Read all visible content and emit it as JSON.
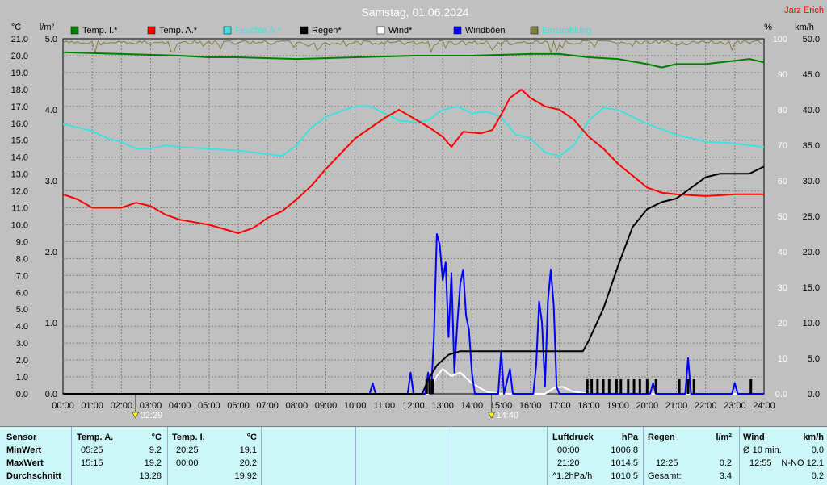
{
  "title": "Samstag, 01.06.2024",
  "author": "Jarz Erich",
  "colors": {
    "temp_i": "#008000",
    "temp_a": "#ff0000",
    "feuchte_a": "#40e0e0",
    "regen": "#000000",
    "wind": "#ffffff",
    "windboeen": "#0000ff",
    "einstrahlung": "#808040"
  },
  "chart_data": {
    "type": "line",
    "x_unit": "time of day (h)",
    "x_ticks": [
      "00:00",
      "01:00",
      "02:00",
      "03:00",
      "04:00",
      "05:00",
      "06:00",
      "07:00",
      "08:00",
      "09:00",
      "10:00",
      "11:00",
      "12:00",
      "13:00",
      "14:00",
      "15:00",
      "16:00",
      "17:00",
      "18:00",
      "19:00",
      "20:00",
      "21:00",
      "22:00",
      "23:00",
      "24:00"
    ],
    "y_left_temp": {
      "label": "°C",
      "range": [
        0,
        21
      ],
      "ticks": [
        "0.0",
        "1.0",
        "2.0",
        "3.0",
        "4.0",
        "5.0",
        "6.0",
        "7.0",
        "8.0",
        "9.0",
        "10.0",
        "11.0",
        "12.0",
        "13.0",
        "14.0",
        "15.0",
        "16.0",
        "17.0",
        "18.0",
        "19.0",
        "20.0",
        "21.0"
      ]
    },
    "y_left_rain": {
      "label": "l/m²",
      "range": [
        0,
        5
      ],
      "ticks": [
        "0.0",
        "1.0",
        "2.0",
        "3.0",
        "4.0",
        "5.0"
      ]
    },
    "y_right_hum": {
      "label": "%",
      "range": [
        0,
        100
      ],
      "ticks": [
        "0.0",
        "10",
        "20",
        "30",
        "40",
        "50",
        "60",
        "70",
        "80",
        "90",
        "100"
      ]
    },
    "y_right_wind": {
      "label": "km/h",
      "range": [
        0,
        50
      ],
      "ticks": [
        "0.0",
        "5.0",
        "10.0",
        "15.0",
        "20.0",
        "25.0",
        "30.0",
        "35.0",
        "40.0",
        "45.0",
        "50.0"
      ]
    },
    "legend": [
      "Temp. I.*",
      "Temp. A.*",
      "Feuchte A.*",
      "Regen*",
      "Wind*",
      "Windböen",
      "Einstrahlung"
    ],
    "sun_markers": [
      {
        "time": 2.48,
        "label": "02:29"
      },
      {
        "time": 14.67,
        "label": "14:40"
      }
    ],
    "series": [
      {
        "name": "Temp. I.*",
        "axis": "temp",
        "points": [
          [
            0,
            20.2
          ],
          [
            2,
            20.1
          ],
          [
            4,
            20.0
          ],
          [
            5,
            19.9
          ],
          [
            6,
            19.9
          ],
          [
            8,
            19.8
          ],
          [
            10,
            19.9
          ],
          [
            12,
            20.0
          ],
          [
            14,
            20.0
          ],
          [
            16,
            20.1
          ],
          [
            17,
            20.1
          ],
          [
            18,
            19.9
          ],
          [
            19,
            19.8
          ],
          [
            20,
            19.5
          ],
          [
            20.5,
            19.3
          ],
          [
            21,
            19.5
          ],
          [
            22,
            19.5
          ],
          [
            23,
            19.7
          ],
          [
            23.5,
            19.8
          ],
          [
            24,
            19.6
          ]
        ]
      },
      {
        "name": "Temp. A.*",
        "axis": "temp",
        "points": [
          [
            0,
            11.8
          ],
          [
            0.5,
            11.5
          ],
          [
            1,
            11.0
          ],
          [
            2,
            11.0
          ],
          [
            2.5,
            11.3
          ],
          [
            3,
            11.1
          ],
          [
            3.5,
            10.6
          ],
          [
            4,
            10.3
          ],
          [
            5,
            10.0
          ],
          [
            6,
            9.5
          ],
          [
            6.5,
            9.8
          ],
          [
            7,
            10.4
          ],
          [
            7.5,
            10.8
          ],
          [
            8,
            11.5
          ],
          [
            8.5,
            12.3
          ],
          [
            9,
            13.3
          ],
          [
            9.5,
            14.2
          ],
          [
            10,
            15.1
          ],
          [
            10.5,
            15.7
          ],
          [
            11,
            16.3
          ],
          [
            11.5,
            16.8
          ],
          [
            12,
            16.3
          ],
          [
            12.5,
            15.8
          ],
          [
            13,
            15.2
          ],
          [
            13.3,
            14.6
          ],
          [
            13.7,
            15.5
          ],
          [
            14.3,
            15.4
          ],
          [
            14.7,
            15.6
          ],
          [
            15,
            16.5
          ],
          [
            15.3,
            17.5
          ],
          [
            15.7,
            18.0
          ],
          [
            16,
            17.5
          ],
          [
            16.5,
            17.0
          ],
          [
            17,
            16.8
          ],
          [
            17.5,
            16.2
          ],
          [
            18,
            15.2
          ],
          [
            18.5,
            14.5
          ],
          [
            19,
            13.6
          ],
          [
            19.5,
            12.9
          ],
          [
            20,
            12.2
          ],
          [
            20.5,
            11.9
          ],
          [
            21,
            11.8
          ],
          [
            22,
            11.7
          ],
          [
            23,
            11.8
          ],
          [
            24,
            11.8
          ]
        ]
      },
      {
        "name": "Feuchte A.*",
        "axis": "hum",
        "points": [
          [
            0,
            76
          ],
          [
            0.5,
            75
          ],
          [
            1,
            74
          ],
          [
            1.5,
            72
          ],
          [
            2,
            71
          ],
          [
            2.5,
            69
          ],
          [
            3,
            69
          ],
          [
            3.5,
            70
          ],
          [
            4,
            69.5
          ],
          [
            5,
            69
          ],
          [
            6,
            68.5
          ],
          [
            7,
            67.5
          ],
          [
            7.5,
            67
          ],
          [
            8,
            70
          ],
          [
            8.5,
            75
          ],
          [
            9,
            78
          ],
          [
            10,
            81
          ],
          [
            10.5,
            81
          ],
          [
            11,
            79
          ],
          [
            11.5,
            77
          ],
          [
            12,
            76.5
          ],
          [
            12.5,
            77
          ],
          [
            13,
            80
          ],
          [
            13.5,
            81
          ],
          [
            14,
            79
          ],
          [
            14.5,
            79.5
          ],
          [
            15,
            78
          ],
          [
            15.5,
            73
          ],
          [
            16,
            72
          ],
          [
            16.5,
            68
          ],
          [
            17,
            67
          ],
          [
            17.5,
            70
          ],
          [
            18,
            77
          ],
          [
            18.5,
            80.5
          ],
          [
            19,
            80
          ],
          [
            19.5,
            78
          ],
          [
            20,
            76
          ],
          [
            21,
            73
          ],
          [
            22,
            71
          ],
          [
            23,
            70.5
          ],
          [
            24,
            69.5
          ]
        ]
      },
      {
        "name": "Regen*",
        "axis": "rain",
        "points": [
          [
            0,
            0
          ],
          [
            12.3,
            0
          ],
          [
            12.5,
            0.2
          ],
          [
            12.8,
            0.4
          ],
          [
            13.2,
            0.55
          ],
          [
            13.6,
            0.6
          ],
          [
            17.6,
            0.6
          ],
          [
            17.8,
            0.6
          ],
          [
            18,
            0.75
          ],
          [
            18.5,
            1.2
          ],
          [
            19,
            1.8
          ],
          [
            19.5,
            2.35
          ],
          [
            20,
            2.6
          ],
          [
            20.5,
            2.7
          ],
          [
            21,
            2.75
          ],
          [
            21.5,
            2.9
          ],
          [
            22,
            3.05
          ],
          [
            22.5,
            3.1
          ],
          [
            23.5,
            3.1
          ],
          [
            24,
            3.2
          ]
        ]
      },
      {
        "name": "Wind*",
        "axis": "wind",
        "points": [
          [
            0,
            0
          ],
          [
            12.5,
            0
          ],
          [
            12.8,
            2.5
          ],
          [
            13.0,
            3.5
          ],
          [
            13.3,
            2.5
          ],
          [
            13.6,
            3.0
          ],
          [
            14,
            1.5
          ],
          [
            14.5,
            0.3
          ],
          [
            15,
            0
          ],
          [
            16.5,
            0
          ],
          [
            16.8,
            0.8
          ],
          [
            17.1,
            1.0
          ],
          [
            17.4,
            0.4
          ],
          [
            18,
            0
          ],
          [
            24,
            0
          ]
        ]
      },
      {
        "name": "Windböen",
        "axis": "wind",
        "points": [
          [
            0,
            0
          ],
          [
            10.5,
            0
          ],
          [
            10.6,
            1.5
          ],
          [
            10.7,
            0
          ],
          [
            11.8,
            0
          ],
          [
            11.9,
            3.0
          ],
          [
            12.0,
            0
          ],
          [
            12.4,
            0
          ],
          [
            12.5,
            3.0
          ],
          [
            12.6,
            0
          ],
          [
            12.7,
            8
          ],
          [
            12.8,
            22.5
          ],
          [
            12.9,
            21
          ],
          [
            13.0,
            16
          ],
          [
            13.1,
            18.5
          ],
          [
            13.2,
            8
          ],
          [
            13.3,
            17
          ],
          [
            13.4,
            3
          ],
          [
            13.5,
            10
          ],
          [
            13.6,
            15.5
          ],
          [
            13.7,
            17.5
          ],
          [
            13.8,
            11
          ],
          [
            13.9,
            9
          ],
          [
            14.0,
            3
          ],
          [
            14.1,
            0
          ],
          [
            14.9,
            0
          ],
          [
            15.0,
            6
          ],
          [
            15.1,
            0
          ],
          [
            15.3,
            3.5
          ],
          [
            15.4,
            0
          ],
          [
            16.1,
            0
          ],
          [
            16.2,
            4
          ],
          [
            16.3,
            13
          ],
          [
            16.4,
            10
          ],
          [
            16.5,
            1
          ],
          [
            16.6,
            13
          ],
          [
            16.7,
            17.5
          ],
          [
            16.8,
            12.5
          ],
          [
            16.9,
            1
          ],
          [
            17.0,
            0
          ],
          [
            20.1,
            0
          ],
          [
            20.2,
            1.5
          ],
          [
            20.3,
            0
          ],
          [
            21.3,
            0
          ],
          [
            21.4,
            5
          ],
          [
            21.5,
            0
          ],
          [
            22.9,
            0
          ],
          [
            23.0,
            1.5
          ],
          [
            23.1,
            0
          ],
          [
            24,
            0
          ]
        ]
      }
    ],
    "rain_events": [
      12.45,
      12.55,
      12.65,
      17.95,
      18.1,
      18.3,
      18.5,
      18.7,
      18.95,
      19.1,
      19.35,
      19.55,
      19.75,
      20.0,
      20.3,
      21.1,
      21.4,
      21.6,
      23.55
    ]
  },
  "table": {
    "sensor_col": {
      "header": "Sensor",
      "rows": [
        "MinWert",
        "MaxWert",
        "Durchschnitt"
      ]
    },
    "temp_a": {
      "header": "Temp. A.",
      "unit": "°C",
      "rows": [
        [
          "05:25",
          "9.2"
        ],
        [
          "15:15",
          "19.2"
        ],
        [
          "",
          "13.28"
        ]
      ]
    },
    "temp_i": {
      "header": "Temp. I.",
      "unit": "°C",
      "rows": [
        [
          "20:25",
          "19.1"
        ],
        [
          "00:00",
          "20.2"
        ],
        [
          "",
          "19.92"
        ]
      ]
    },
    "luftdruck": {
      "header": "Luftdruck",
      "unit": "hPa",
      "rows": [
        [
          "00:00",
          "1006.8"
        ],
        [
          "21:20",
          "1014.5"
        ],
        [
          "^1.2hPa/h",
          "1010.5"
        ]
      ]
    },
    "regen": {
      "header": "Regen",
      "unit": "l/m²",
      "rows": [
        [
          "",
          ""
        ],
        [
          "12:25",
          "0.2"
        ],
        [
          "Gesamt:",
          "3.4"
        ]
      ]
    },
    "wind": {
      "header": "Wind",
      "unit": "km/h",
      "rows": [
        [
          "Ø 10 min.",
          "0.0"
        ],
        [
          "12:55",
          "N-NO 12.1"
        ],
        [
          "",
          "0.2"
        ]
      ]
    }
  }
}
